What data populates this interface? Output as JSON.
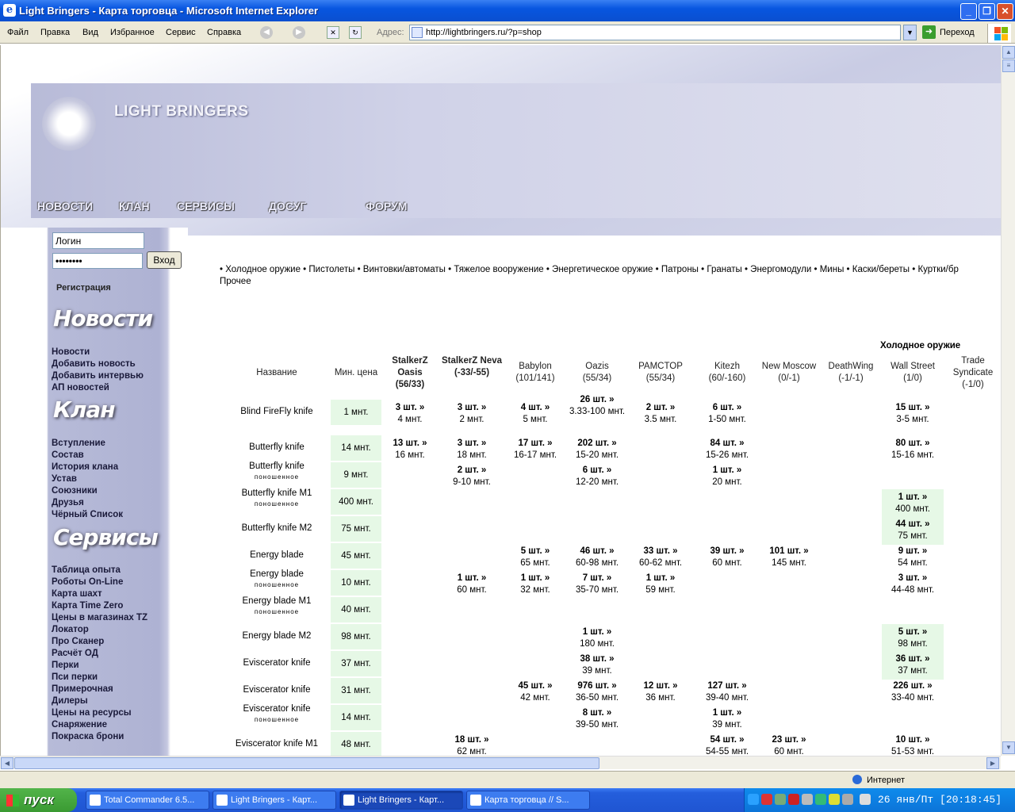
{
  "window": {
    "title": "Light Bringers - Карта торговца - Microsoft Internet Explorer"
  },
  "menu": [
    "Файл",
    "Правка",
    "Вид",
    "Избранное",
    "Сервис",
    "Справка"
  ],
  "address": {
    "label": "Адрес:",
    "url": "http://lightbringers.ru/?p=shop",
    "go": "Переход"
  },
  "site": {
    "logo": "LIGHT BRINGERS",
    "nav": [
      "НОВОСТИ",
      "КЛАН",
      "СЕРВИСЫ",
      "ДОСУГ",
      "ФОРУМ"
    ]
  },
  "login": {
    "login_value": "Логин",
    "password_value": "••••••••",
    "button": "Вход",
    "register": "Регистрация"
  },
  "sidebar": {
    "news_head": "Новости",
    "news": [
      "Новости",
      "Добавить новость",
      "Добавить интервью",
      "АП новостей"
    ],
    "clan_head": "Клан",
    "clan": [
      "Вступление",
      "Состав",
      "История клана",
      "Устав",
      "Союзники",
      "Друзья",
      "Чёрный Список"
    ],
    "services_head": "Сервисы",
    "services": [
      "Таблица опыта",
      "Роботы On-Line",
      "Карта шахт",
      "Карта Time Zero",
      "Цены в магазинах TZ",
      "Локатор",
      "Про Сканер",
      "Расчёт ОД",
      "Перки",
      "Пси перки",
      "Примерочная",
      "Дилеры",
      "Цены на ресурсы",
      "Снаряжение",
      "Покраска брони"
    ]
  },
  "categories": {
    "line1": "• Холодное оружие • Пистолеты • Винтовки/автоматы • Тяжелое вооружение • Энергетическое оружие • Патроны • Гранаты • Энергомодули • Мины • Каски/береты • Куртки/бр",
    "line2": "Прочее",
    "current": "Холодное оружие"
  },
  "table": {
    "col_name": "Название",
    "col_min": "Мин. цена",
    "shops": [
      {
        "name": "StalkerZ Oasis",
        "coord": "(56/33)",
        "bold": true
      },
      {
        "name": "StalkerZ Neva",
        "coord": "(-33/-55)",
        "bold": true
      },
      {
        "name": "Babylon",
        "coord": "(101/141)",
        "bold": false
      },
      {
        "name": "Oazis",
        "coord": "(55/34)",
        "bold": false
      },
      {
        "name": "PAMCTOP",
        "coord": "(55/34)",
        "bold": false
      },
      {
        "name": "Kitezh",
        "coord": "(60/-160)",
        "bold": false
      },
      {
        "name": "New Moscow",
        "coord": "(0/-1)",
        "bold": false
      },
      {
        "name": "DeathWing",
        "coord": "(-1/-1)",
        "bold": false
      },
      {
        "name": "Wall Street",
        "coord": "(1/0)",
        "bold": false
      },
      {
        "name": "Trade Syndicate",
        "coord": "(-1/0)",
        "bold": false
      }
    ],
    "rows": [
      {
        "name": "Blind FireFly knife",
        "sub": "",
        "min": "1 мнт.",
        "cells": [
          [
            "3 шт. »",
            "4 мнт."
          ],
          [
            "3 шт. »",
            "2 мнт."
          ],
          [
            "4 шт. »",
            "5 мнт."
          ],
          [
            "26 шт. »",
            "3.33-100 мнт."
          ],
          [
            "2 шт. »",
            "3.5 мнт."
          ],
          [
            "6 шт. »",
            "1-50 мнт."
          ],
          null,
          null,
          [
            "15 шт. »",
            "3-5 мнт."
          ],
          null
        ]
      },
      {
        "name": "Butterfly knife",
        "sub": "",
        "min": "14 мнт.",
        "cells": [
          [
            "13 шт. »",
            "16 мнт."
          ],
          [
            "3 шт. »",
            "18 мнт."
          ],
          [
            "17 шт. »",
            "16-17 мнт."
          ],
          [
            "202 шт. »",
            "15-20 мнт."
          ],
          null,
          [
            "84 шт. »",
            "15-26 мнт."
          ],
          null,
          null,
          [
            "80 шт. »",
            "15-16 мнт."
          ],
          null
        ]
      },
      {
        "name": "Butterfly knife",
        "sub": "поношенное",
        "min": "9 мнт.",
        "cells": [
          null,
          [
            "2 шт. »",
            "9-10 мнт."
          ],
          null,
          [
            "6 шт. »",
            "12-20 мнт."
          ],
          null,
          [
            "1 шт. »",
            "20 мнт."
          ],
          null,
          null,
          null,
          null
        ]
      },
      {
        "name": "Butterfly knife M1",
        "sub": "поношенное",
        "min": "400 мнт.",
        "cells": [
          null,
          null,
          null,
          null,
          null,
          null,
          null,
          null,
          [
            "1 шт. »",
            "400 мнт."
          ],
          null
        ]
      },
      {
        "name": "Butterfly knife M2",
        "sub": "",
        "min": "75 мнт.",
        "cells": [
          null,
          null,
          null,
          null,
          null,
          null,
          null,
          null,
          [
            "44 шт. »",
            "75 мнт."
          ],
          null
        ]
      },
      {
        "name": "Energy blade",
        "sub": "",
        "min": "45 мнт.",
        "cells": [
          null,
          null,
          [
            "5 шт. »",
            "65 мнт."
          ],
          [
            "46 шт. »",
            "60-98 мнт."
          ],
          [
            "33 шт. »",
            "60-62 мнт."
          ],
          [
            "39 шт. »",
            "60 мнт."
          ],
          [
            "101 шт. »",
            "145 мнт."
          ],
          null,
          [
            "9 шт. »",
            "54 мнт."
          ],
          null
        ]
      },
      {
        "name": "Energy blade",
        "sub": "поношенное",
        "min": "10 мнт.",
        "cells": [
          null,
          [
            "1 шт. »",
            "60 мнт."
          ],
          [
            "1 шт. »",
            "32 мнт."
          ],
          [
            "7 шт. »",
            "35-70 мнт."
          ],
          [
            "1 шт. »",
            "59 мнт."
          ],
          null,
          null,
          null,
          [
            "3 шт. »",
            "44-48 мнт."
          ],
          null
        ]
      },
      {
        "name": "Energy blade M1",
        "sub": "поношенное",
        "min": "40 мнт.",
        "cells": [
          null,
          null,
          null,
          null,
          null,
          null,
          null,
          null,
          null,
          null
        ]
      },
      {
        "name": "Energy blade M2",
        "sub": "",
        "min": "98 мнт.",
        "cells": [
          null,
          null,
          null,
          [
            "1 шт. »",
            "180 мнт."
          ],
          null,
          null,
          null,
          null,
          [
            "5 шт. »",
            "98 мнт."
          ],
          null
        ]
      },
      {
        "name": "Eviscerator knife",
        "sub": "",
        "min": "37 мнт.",
        "cells": [
          null,
          null,
          null,
          [
            "38 шт. »",
            "39 мнт."
          ],
          null,
          null,
          null,
          null,
          [
            "36 шт. »",
            "37 мнт."
          ],
          null
        ]
      },
      {
        "name": "Eviscerator knife",
        "sub": "",
        "min": "31 мнт.",
        "cells": [
          null,
          null,
          [
            "45 шт. »",
            "42 мнт."
          ],
          [
            "976 шт. »",
            "36-50 мнт."
          ],
          [
            "12 шт. »",
            "36 мнт."
          ],
          [
            "127 шт. »",
            "39-40 мнт."
          ],
          null,
          null,
          [
            "226 шт. »",
            "33-40 мнт."
          ],
          null
        ]
      },
      {
        "name": "Eviscerator knife",
        "sub": "поношенное",
        "min": "14 мнт.",
        "cells": [
          null,
          null,
          null,
          [
            "8 шт. »",
            "39-50 мнт."
          ],
          null,
          [
            "1 шт. »",
            "39 мнт."
          ],
          null,
          null,
          null,
          null
        ]
      },
      {
        "name": "Eviscerator knife M1",
        "sub": "",
        "min": "48 мнт.",
        "cells": [
          null,
          [
            "18 шт. »",
            "62 мнт."
          ],
          null,
          null,
          null,
          [
            "54 шт. »",
            "54-55 мнт."
          ],
          [
            "23 шт. »",
            "60 мнт."
          ],
          null,
          [
            "10 шт. »",
            "51-53 мнт."
          ],
          null
        ]
      }
    ]
  },
  "status": {
    "zone": "Интернет"
  },
  "taskbar": {
    "start": "пуск",
    "tasks": [
      "Total Commander 6.5...",
      "Light Bringers - Карт...",
      "Light Bringers - Карт...",
      "Карта торговца // S..."
    ],
    "clock": "26 янв/Пт [20:18:45]"
  }
}
